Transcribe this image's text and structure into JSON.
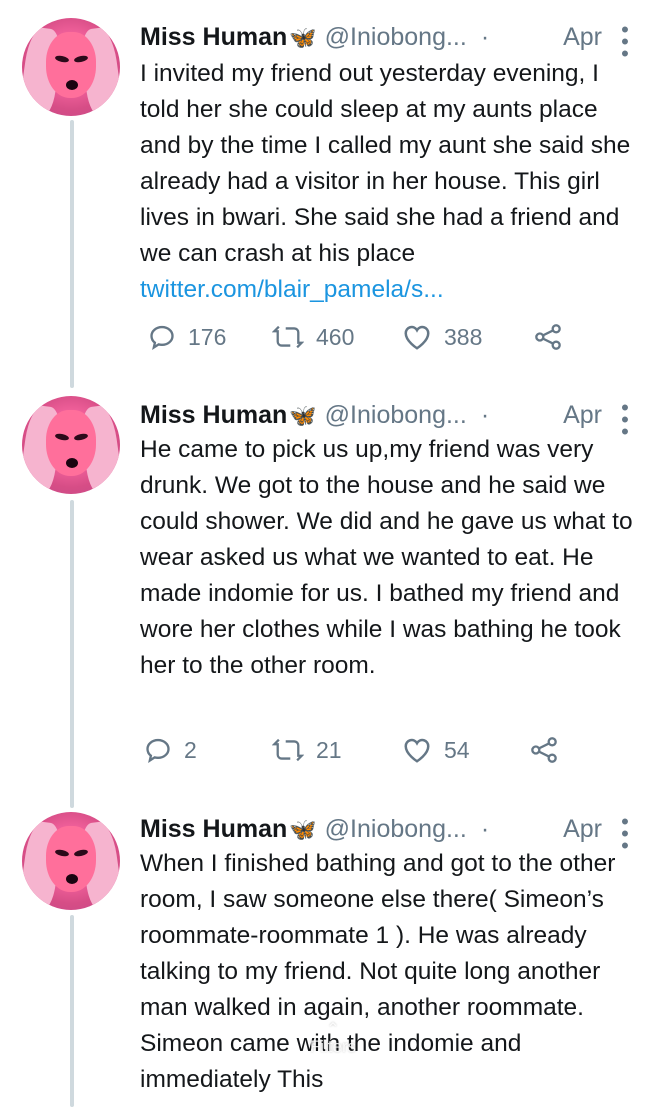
{
  "tweets": [
    {
      "name": "Miss Human",
      "emoji": "🦋",
      "handle": "@Iniobong...",
      "dot": "·",
      "date": "Apr",
      "text": "I invited my friend out yesterday evening, I told her she could sleep at my aunts place and by the time I called my aunt she said she already had a visitor in her house. This girl lives in bwari. She said she had a friend and we can crash at his place ",
      "link": "twitter.com/blair_pamela/s...",
      "replies": "176",
      "retweets": "460",
      "likes": "388"
    },
    {
      "name": "Miss Human",
      "emoji": "🦋",
      "handle": "@Iniobong...",
      "dot": "·",
      "date": "Apr",
      "text": "He came to pick us up,my friend was very drunk. We got to the house and he said we could shower. We did and he gave us what to wear asked us what we wanted to eat. He made indomie for us. I bathed my friend and wore her clothes while I was bathing he took her to the other room.",
      "replies": "2",
      "retweets": "21",
      "likes": "54"
    },
    {
      "name": "Miss Human",
      "emoji": "🦋",
      "handle": "@Iniobong...",
      "dot": "·",
      "date": "Apr",
      "text": "When I finished bathing and got to the other room, I saw someone else there( Simeon’s roommate-roommate 1 ). He was already talking to my friend. Not quite long another man walked in again, another roommate. Simeon came with the indomie and immediately This"
    }
  ],
  "overlay": {
    "label": "Filters"
  },
  "icons": {
    "reply": "reply-icon",
    "retweet": "retweet-icon",
    "like": "heart-icon",
    "share": "share-icon",
    "menu": "more-vertical-icon"
  },
  "colors": {
    "link": "#1b95e0",
    "meta": "#657786",
    "thread_line": "#cfd9de"
  }
}
